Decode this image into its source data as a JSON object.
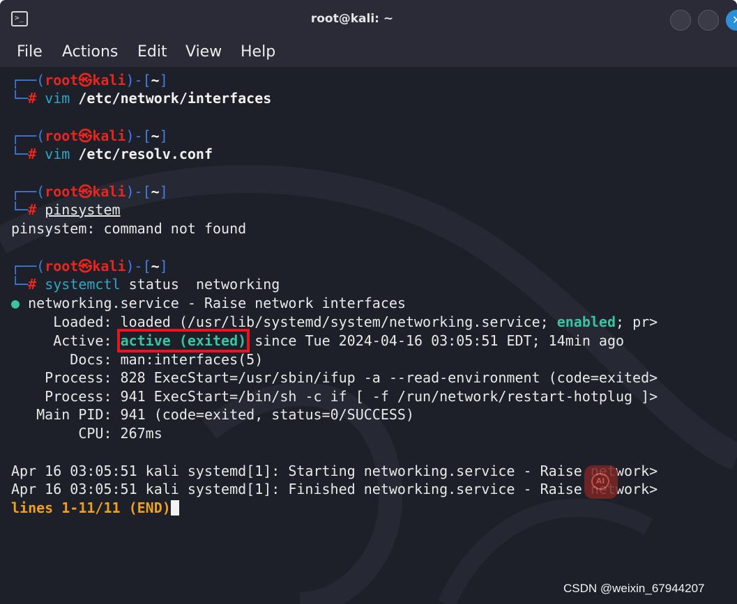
{
  "window": {
    "title": "root@kali: ~",
    "close_glyph": "✕",
    "terminal_glyph": ">_"
  },
  "menu": [
    "File",
    "Actions",
    "Edit",
    "View",
    "Help"
  ],
  "prompt": {
    "open": "┌──(",
    "user": "root",
    "at": "㉿",
    "host": "kali",
    "mid": ")-[",
    "dir": "~",
    "close": "]",
    "cmd_prefix": "└─",
    "hash": "#"
  },
  "commands": [
    {
      "cmd": "vim",
      "arg": "/etc/network/interfaces"
    },
    {
      "cmd": "vim",
      "arg": "/etc/resolv.conf"
    },
    {
      "cmd": "pinsystem",
      "arg": ""
    },
    {
      "cmd": "systemctl",
      "arg": "status  networking"
    }
  ],
  "error_line": "pinsystem: command not found",
  "status": {
    "dot": "●",
    "service_line": "networking.service - Raise network interfaces",
    "loaded_label": "Loaded:",
    "loaded_pre": "loaded (/usr/lib/systemd/system/networking.service; ",
    "loaded_enabled": "enabled",
    "loaded_post": "; pr>",
    "active_label": "Active:",
    "active_value": "active (exited)",
    "active_post": "since Tue 2024-04-16 03:05:51 EDT; 14min ago",
    "docs_label": "Docs:",
    "docs_value": "man:interfaces(5)",
    "process_label": "Process:",
    "process1": "828 ExecStart=/usr/sbin/ifup -a --read-environment (code=exited>",
    "process2": "941 ExecStart=/bin/sh -c if [ -f /run/network/restart-hotplug ]>",
    "mainpid_label": "Main PID:",
    "mainpid_value": "941 (code=exited, status=0/SUCCESS)",
    "cpu_label": "CPU:",
    "cpu_value": "267ms"
  },
  "logs": [
    "Apr 16 03:05:51 kali systemd[1]: Starting networking.service - Raise network>",
    "Apr 16 03:05:51 kali systemd[1]: Finished networking.service - Raise network>"
  ],
  "pager": "lines 1-11/11 (END)",
  "ai_logo_text": "AI",
  "watermark": "CSDN @weixin_67944207"
}
